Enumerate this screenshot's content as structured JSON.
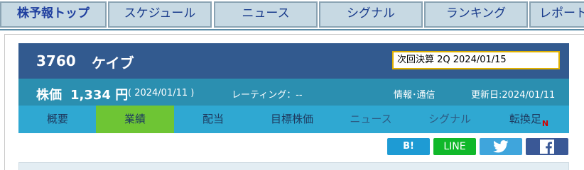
{
  "top_nav": {
    "tabs": [
      {
        "label": "株予報トップ"
      },
      {
        "label": "スケジュール"
      },
      {
        "label": "ニュース"
      },
      {
        "label": "シグナル"
      },
      {
        "label": "ランキング"
      },
      {
        "label": "レポート"
      }
    ]
  },
  "stock": {
    "code": "3760",
    "name": "ケイブ",
    "next_settlement": "次回決算 2Q 2024/01/15",
    "price_label": "株価",
    "price_value": "1,334 円",
    "price_date": "( 2024/01/11 )",
    "rating": "レーティング：--",
    "sector": "情報･通信",
    "updated": "更新日:2024/01/11"
  },
  "sub_tabs": {
    "items": [
      {
        "label": "概要"
      },
      {
        "label": "業績"
      },
      {
        "label": "配当"
      },
      {
        "label": "目標株価"
      },
      {
        "label": "ニュース"
      },
      {
        "label": "シグナル"
      },
      {
        "label": "転換足"
      }
    ],
    "badge": "N"
  },
  "share": {
    "hatena": "B!",
    "line": "LINE",
    "twitter_icon": "twitter-bird-icon",
    "facebook_icon": "facebook-f-icon"
  },
  "colors": {
    "header_bg": "#325a8f",
    "price_row_bg": "#2b8fb0",
    "subtab_bg": "#2fa8d2",
    "subtab_active": "#6ec534",
    "next_settle_border": "#e0b000"
  }
}
